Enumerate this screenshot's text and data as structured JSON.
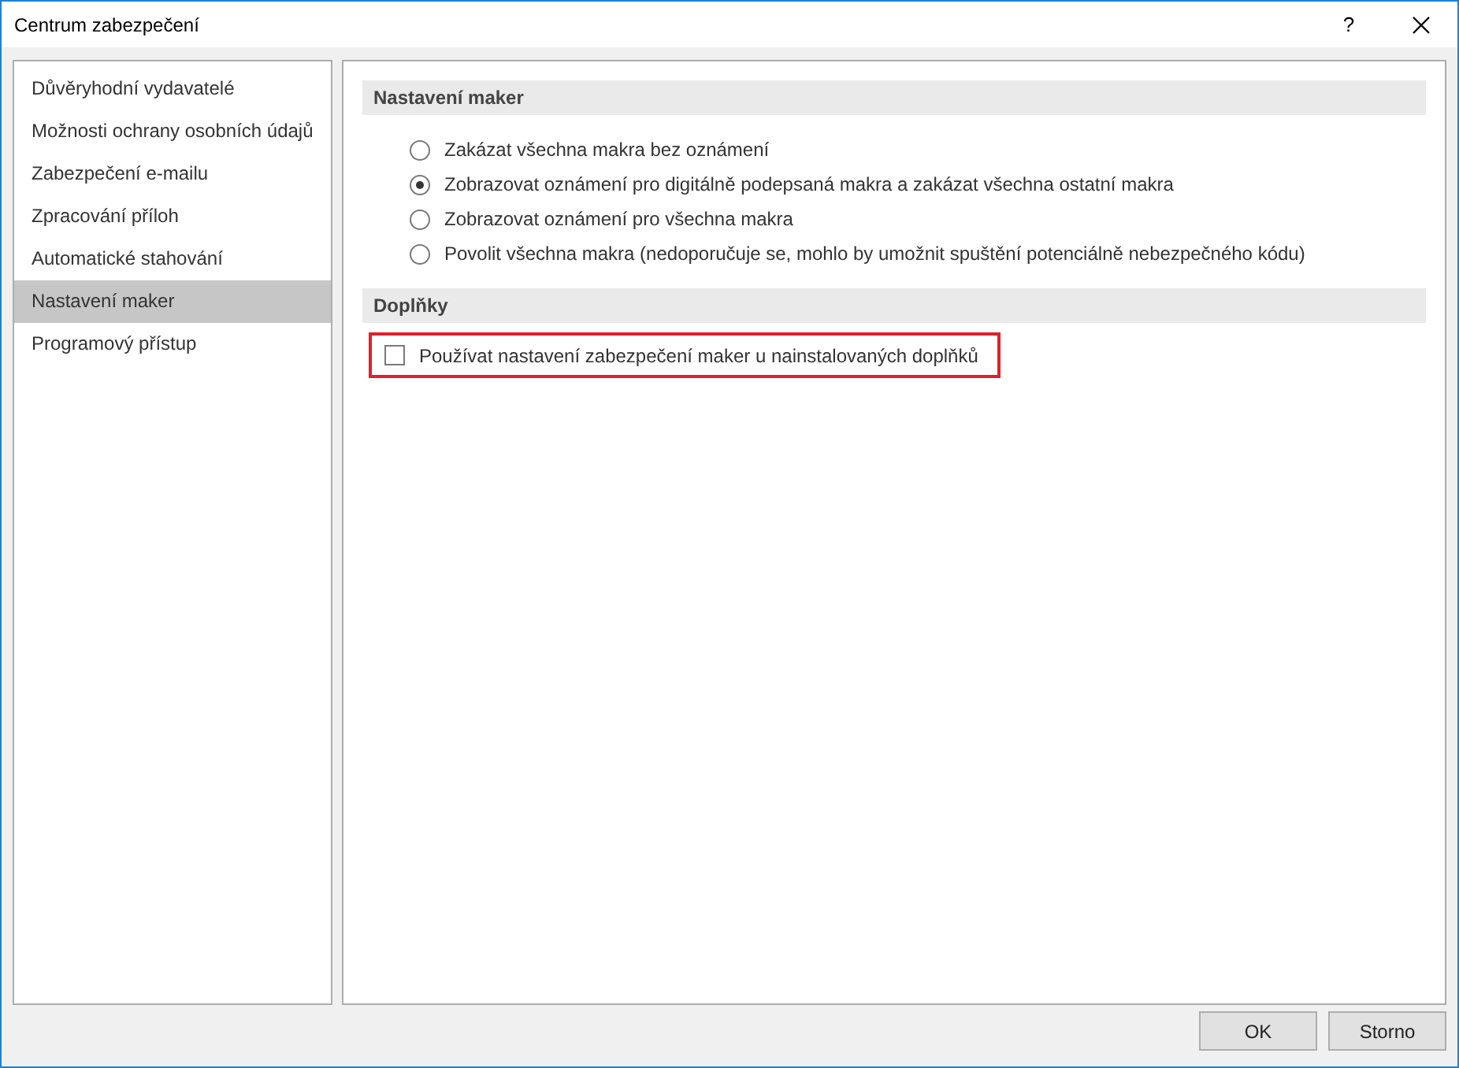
{
  "window": {
    "title": "Centrum zabezpečení",
    "help": "?"
  },
  "sidebar": {
    "items": [
      {
        "label": "Důvěryhodní vydavatelé",
        "selected": false
      },
      {
        "label": "Možnosti ochrany osobních údajů",
        "selected": false
      },
      {
        "label": "Zabezpečení e-mailu",
        "selected": false
      },
      {
        "label": "Zpracování příloh",
        "selected": false
      },
      {
        "label": "Automatické stahování",
        "selected": false
      },
      {
        "label": "Nastavení maker",
        "selected": true
      },
      {
        "label": "Programový přístup",
        "selected": false
      }
    ]
  },
  "sections": [
    {
      "title": "Nastavení maker",
      "options": [
        {
          "kind": "radio",
          "label": "Zakázat všechna makra bez oznámení",
          "selected": false
        },
        {
          "kind": "radio",
          "label": "Zobrazovat oznámení pro digitálně podepsaná makra a zakázat všechna ostatní makra",
          "selected": true
        },
        {
          "kind": "radio",
          "label": "Zobrazovat oznámení pro všechna makra",
          "selected": false
        },
        {
          "kind": "radio",
          "label": "Povolit všechna makra (nedoporučuje se, mohlo by umožnit spuštění potenciálně nebezpečného kódu)",
          "selected": false
        }
      ]
    },
    {
      "title": "Doplňky",
      "options": [
        {
          "kind": "checkbox",
          "label": "Používat nastavení zabezpečení maker u nainstalovaných doplňků",
          "checked": false,
          "highlighted": true
        }
      ]
    }
  ],
  "buttons": [
    "OK",
    "Storno"
  ]
}
